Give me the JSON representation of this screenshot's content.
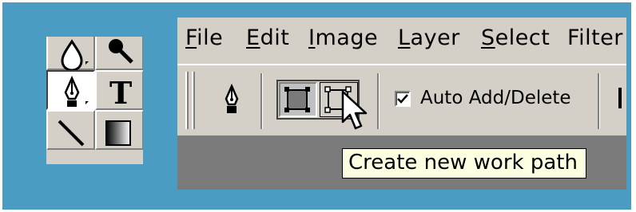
{
  "menubar": {
    "items": [
      {
        "label": "File",
        "mnemonic": "F",
        "rest": "ile"
      },
      {
        "label": "Edit",
        "mnemonic": "E",
        "rest": "dit"
      },
      {
        "label": "Image",
        "mnemonic": "I",
        "rest": "mage"
      },
      {
        "label": "Layer",
        "mnemonic": "L",
        "rest": "ayer"
      },
      {
        "label": "Select",
        "mnemonic": "S",
        "rest": "elect"
      },
      {
        "label": "Filter",
        "mnemonic": "",
        "rest": "Filter"
      }
    ]
  },
  "toolbox": {
    "tools": [
      {
        "name": "blur-tool",
        "active": false
      },
      {
        "name": "burn-tool",
        "active": false
      },
      {
        "name": "pen-tool",
        "active": true
      },
      {
        "name": "type-tool",
        "active": false,
        "glyph": "T"
      },
      {
        "name": "line-tool",
        "active": false
      },
      {
        "name": "gradient-tool",
        "active": false
      }
    ]
  },
  "options_bar": {
    "pen_icon": "pen-icon",
    "modes": [
      {
        "name": "create-shape-layer",
        "state": "pressed"
      },
      {
        "name": "create-new-work-path",
        "state": "hover"
      }
    ],
    "auto_add_delete": {
      "label": "Auto Add/Delete",
      "checked": true
    }
  },
  "tooltip": {
    "text": "Create new work path"
  },
  "colors": {
    "background": "#4a9cc2",
    "chrome": "#d4d0c8",
    "workarea": "#7b7b7b",
    "tooltip": "#ffffe1"
  }
}
